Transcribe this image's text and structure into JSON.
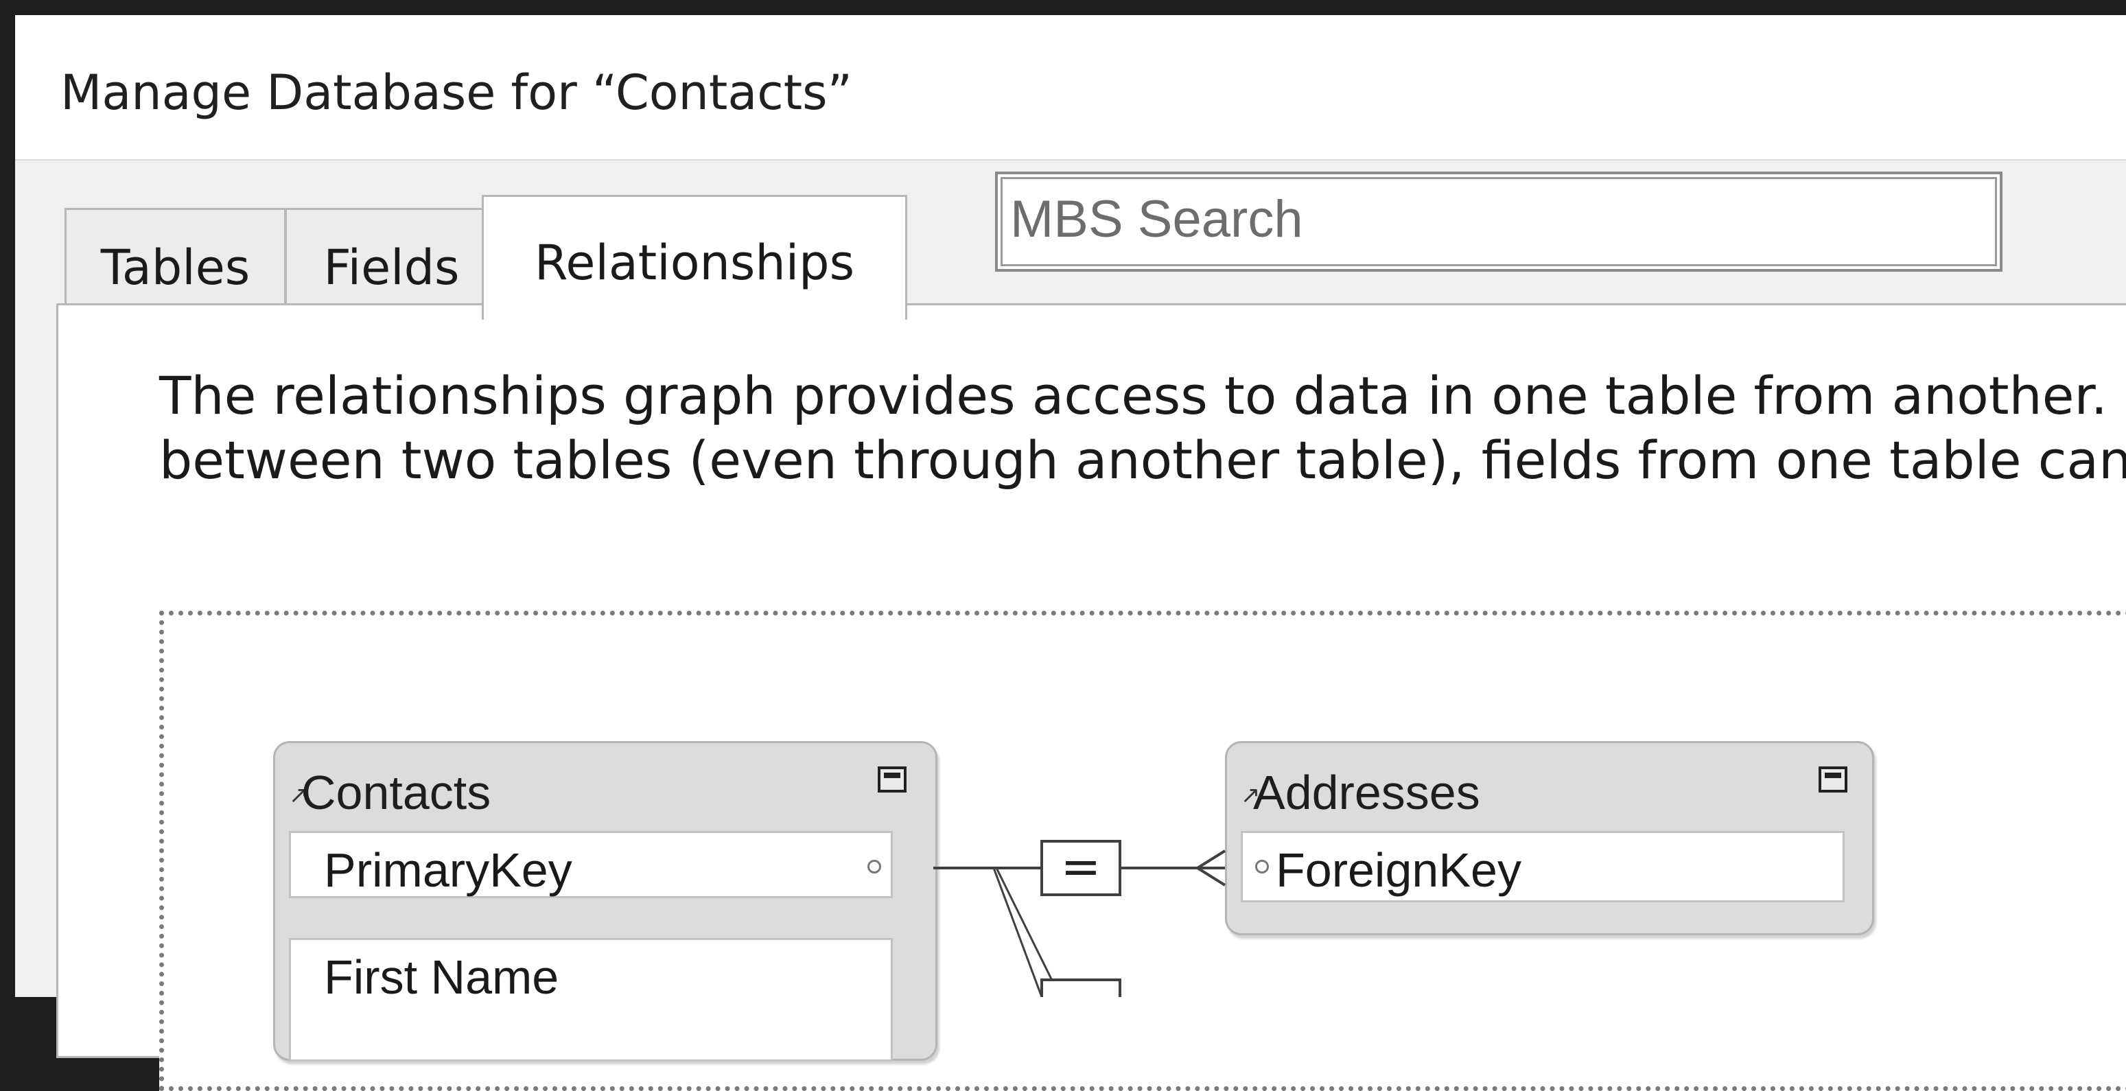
{
  "dialog": {
    "title": "Manage Database for “Contacts”"
  },
  "tabs": [
    {
      "label": "Tables"
    },
    {
      "label": "Fields"
    },
    {
      "label": "Relationships",
      "active": true
    }
  ],
  "search": {
    "placeholder": "MBS Search"
  },
  "description": {
    "line1": "The relationships graph provides access to data in one table from another. I",
    "line2": "between two tables (even through another table), fields from one table can"
  },
  "graph": {
    "tables": [
      {
        "name": "Contacts",
        "fields": [
          "PrimaryKey",
          "First Name"
        ]
      },
      {
        "name": "Addresses",
        "fields": [
          "ForeignKey"
        ]
      }
    ],
    "relationship_operator": "="
  },
  "icons": {
    "table_arrow": "arrow-icon",
    "collapse": "collapse-icon",
    "key": "key-dot-icon"
  }
}
